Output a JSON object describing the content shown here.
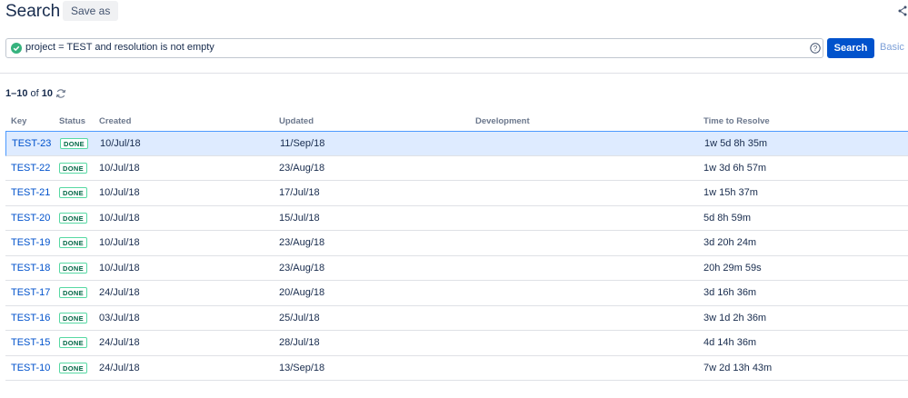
{
  "header": {
    "title": "Search",
    "save_as_label": "Save as"
  },
  "query": {
    "text": "project = TEST and resolution is not empty",
    "search_label": "Search",
    "basic_label": "Basic"
  },
  "results": {
    "range": "1–10",
    "of": "of",
    "total": "10"
  },
  "table": {
    "headers": {
      "key": "Key",
      "status": "Status",
      "created": "Created",
      "updated": "Updated",
      "development": "Development",
      "ttr": "Time to Resolve"
    },
    "rows": [
      {
        "key": "TEST-23",
        "status": "DONE",
        "created": "10/Jul/18",
        "updated": "11/Sep/18",
        "ttr": "1w 5d 8h 35m"
      },
      {
        "key": "TEST-22",
        "status": "DONE",
        "created": "10/Jul/18",
        "updated": "23/Aug/18",
        "ttr": "1w 3d 6h 57m"
      },
      {
        "key": "TEST-21",
        "status": "DONE",
        "created": "10/Jul/18",
        "updated": "17/Jul/18",
        "ttr": "1w 15h 37m"
      },
      {
        "key": "TEST-20",
        "status": "DONE",
        "created": "10/Jul/18",
        "updated": "15/Jul/18",
        "ttr": "5d 8h 59m"
      },
      {
        "key": "TEST-19",
        "status": "DONE",
        "created": "10/Jul/18",
        "updated": "23/Aug/18",
        "ttr": "3d 20h 24m"
      },
      {
        "key": "TEST-18",
        "status": "DONE",
        "created": "10/Jul/18",
        "updated": "23/Aug/18",
        "ttr": "20h 29m 59s"
      },
      {
        "key": "TEST-17",
        "status": "DONE",
        "created": "24/Jul/18",
        "updated": "20/Aug/18",
        "ttr": "3d 16h 36m"
      },
      {
        "key": "TEST-16",
        "status": "DONE",
        "created": "03/Jul/18",
        "updated": "25/Jul/18",
        "ttr": "3w 1d 2h 36m"
      },
      {
        "key": "TEST-15",
        "status": "DONE",
        "created": "24/Jul/18",
        "updated": "28/Jul/18",
        "ttr": "4d 14h 36m"
      },
      {
        "key": "TEST-10",
        "status": "DONE",
        "created": "24/Jul/18",
        "updated": "13/Sep/18",
        "ttr": "7w 2d 13h 43m"
      }
    ]
  },
  "icons": {
    "share": "share-icon",
    "valid": "check-circle-icon",
    "help": "help-icon",
    "refresh": "refresh-icon"
  },
  "colors": {
    "primary": "#0052cc",
    "selected_row": "#deebff",
    "done_text": "#006644",
    "done_border": "#57d9a3"
  }
}
